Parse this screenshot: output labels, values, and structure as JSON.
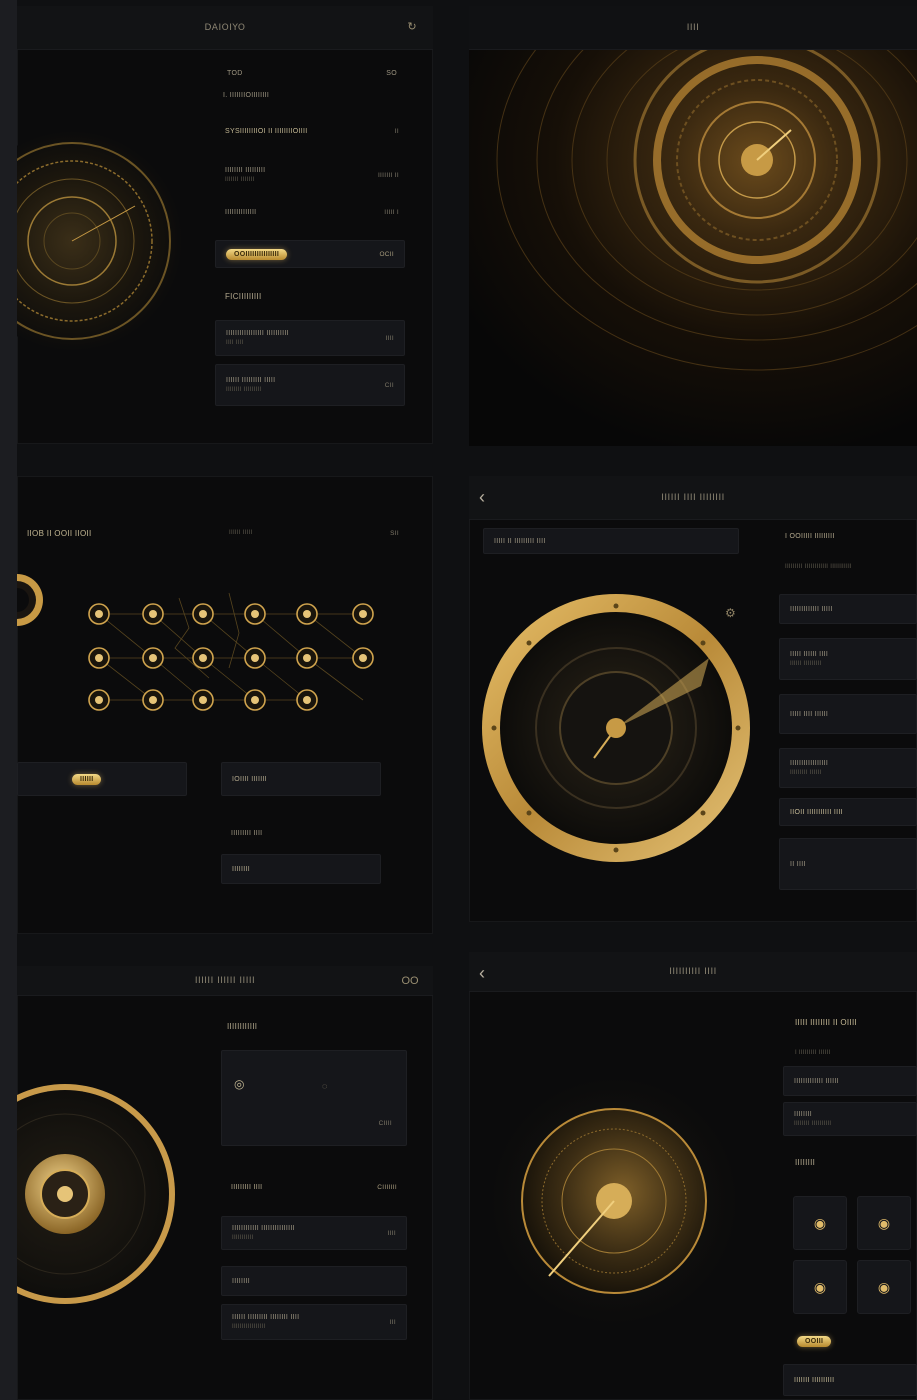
{
  "colors": {
    "background": "#0f1012",
    "panel": "#0b0b0c",
    "card": "#15161a",
    "gold": "#d4a94a",
    "gold_light": "#f3d987",
    "text": "#9e9682"
  },
  "panel1": {
    "title": "DAIOIYO",
    "header_icon": "refresh-icon",
    "tab_row": {
      "left": "TOD",
      "right": "SO"
    },
    "subhead": "I. IIIIIIIOIIIIIIII",
    "rows": [
      {
        "label": "SYSIIIIIIIIOI II IIIIIIIIOIIII",
        "value": "II"
      },
      {
        "label": "IIIIIIII IIIIIIIII",
        "sub": "IIIIIII IIIIIII",
        "value": "IIIIIII II"
      },
      {
        "label": "IIIIIIIIIIIIII",
        "value": "IIIII I"
      }
    ],
    "pill": {
      "label": "OOIIIIIIIIIIIIIII",
      "value": "OCII"
    },
    "section": "FICIIIIIIIII",
    "cards": [
      {
        "label": "IIIIIIIIIIIIIIIII IIIIIIIIII",
        "sub": "IIII IIII",
        "value": "IIII"
      },
      {
        "label": "IIIIII IIIIIIIII IIIII",
        "sub": "IIIIIIII IIIIIIIII",
        "value": "CII"
      }
    ]
  },
  "panel2": {
    "title": "IIII"
  },
  "panel3": {
    "title": "IIOB II OOII IIOII",
    "header_mid": "IIIIII IIIII",
    "header_right": "SII",
    "pill": "IIIIII",
    "card_right": "IOIIII IIIIIII",
    "list": [
      {
        "label": "IIIIIIIII IIII"
      },
      {
        "label": "IIIIIIII"
      }
    ]
  },
  "panel4": {
    "title": "IIIIII IIII IIIIIIII",
    "search_text": "IIIII II IIIIIIIII IIII",
    "side_header": "I OOIIIII IIIIIIIII",
    "side_sub": "IIIIIIIII IIIIIIIIIIII IIIIIIIIIII",
    "items": [
      {
        "label": "IIIIIIIIIIIII IIIII"
      },
      {
        "label": "IIIII IIIIII IIII",
        "sub": "IIIIII IIIIIIIII"
      },
      {
        "label": "IIIII IIII IIIIII"
      },
      {
        "label": "IIIIIIIIIIIIIIIII",
        "sub": "IIIIIIIII IIIIII"
      },
      {
        "label": "IIOII IIIIIIIIIII IIII"
      },
      {
        "label": "II IIII"
      }
    ]
  },
  "panel5": {
    "title": "IIIIII IIIIII IIIII",
    "header_icon": "OO",
    "section": "IIIIIIIIIIII",
    "block_value": "CIIII",
    "rows": [
      {
        "label": "IIIIIIIII IIII",
        "value": "CIIIIIII"
      },
      {
        "label": "IIIIIIIIIIII IIIIIIIIIIIIIII",
        "sub": "IIIIIIIIIII",
        "value": "IIII"
      },
      {
        "label": "IIIIIIII"
      },
      {
        "label": "IIIIII IIIIIIIII IIIIIIII IIII",
        "sub": "IIIIIIIIIIIIIIIII",
        "value": "III"
      }
    ]
  },
  "panel6": {
    "title": "IIIIIIIIII IIII",
    "side_header": "IIIII IIIIIIII II OIIII",
    "side_sub": "I IIIIIIIII IIIIII",
    "cards": [
      {
        "label": "IIIIIIIIIIIII IIIIII"
      },
      {
        "label": "IIIIIIII",
        "sub": "IIIIIIII IIIIIIIIII"
      }
    ],
    "section": "IIIIIIII",
    "pill": "OOIII",
    "footer": "IIIIIII IIIIIIIIII"
  }
}
